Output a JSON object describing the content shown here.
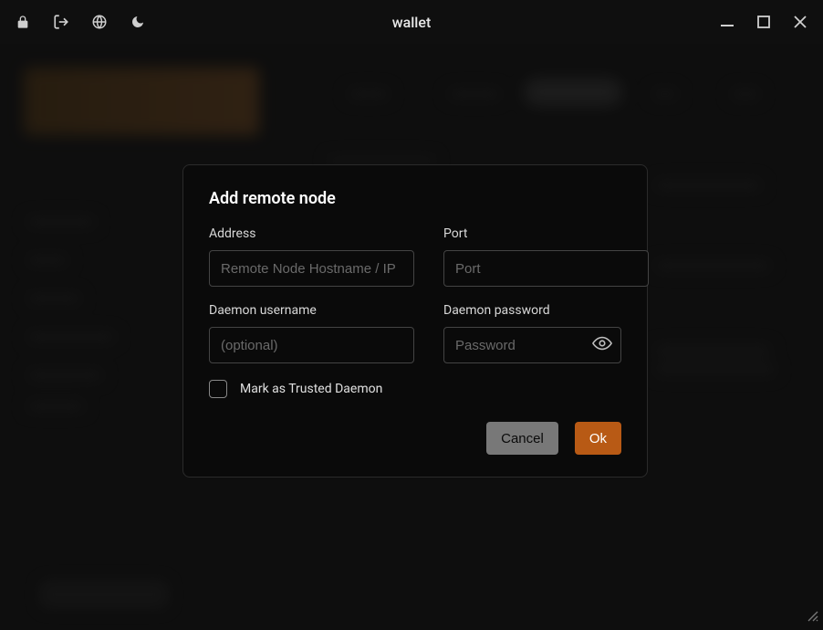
{
  "window": {
    "title": "wallet"
  },
  "dialog": {
    "title": "Add remote node",
    "fields": {
      "address": {
        "label": "Address",
        "placeholder": "Remote Node Hostname / IP",
        "value": ""
      },
      "port": {
        "label": "Port",
        "placeholder": "Port",
        "value": ""
      },
      "username": {
        "label": "Daemon username",
        "placeholder": "(optional)",
        "value": ""
      },
      "password": {
        "label": "Daemon password",
        "placeholder": "Password",
        "value": ""
      }
    },
    "checkbox": {
      "label": "Mark as Trusted Daemon",
      "checked": false
    },
    "buttons": {
      "cancel": "Cancel",
      "ok": "Ok"
    }
  },
  "colors": {
    "accent": "#b85a15",
    "bg": "#0a0a0a",
    "border": "#444"
  }
}
